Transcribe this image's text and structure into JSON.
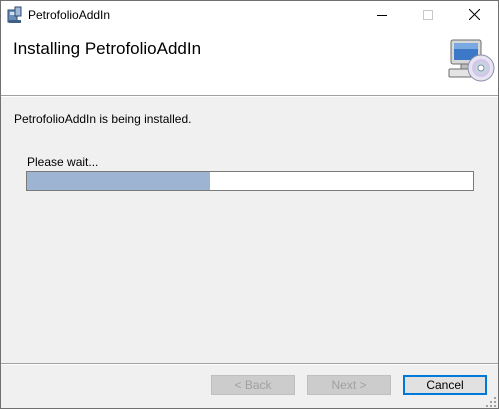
{
  "window": {
    "title": "PetrofolioAddIn"
  },
  "header": {
    "title": "Installing PetrofolioAddIn"
  },
  "body": {
    "status_message": "PetrofolioAddIn is being installed.",
    "wait_label": "Please wait...",
    "progress_fraction": 0.41
  },
  "buttons": {
    "back_label": "< Back",
    "next_label": "Next >",
    "cancel_label": "Cancel"
  },
  "colors": {
    "progress_fill": "#9db4d2",
    "accent": "#0078d7"
  },
  "icons": {
    "app": "installer-package-icon",
    "minimize": "minimize-icon",
    "maximize": "maximize-icon",
    "close": "close-icon",
    "header": "computer-cd-icon"
  }
}
